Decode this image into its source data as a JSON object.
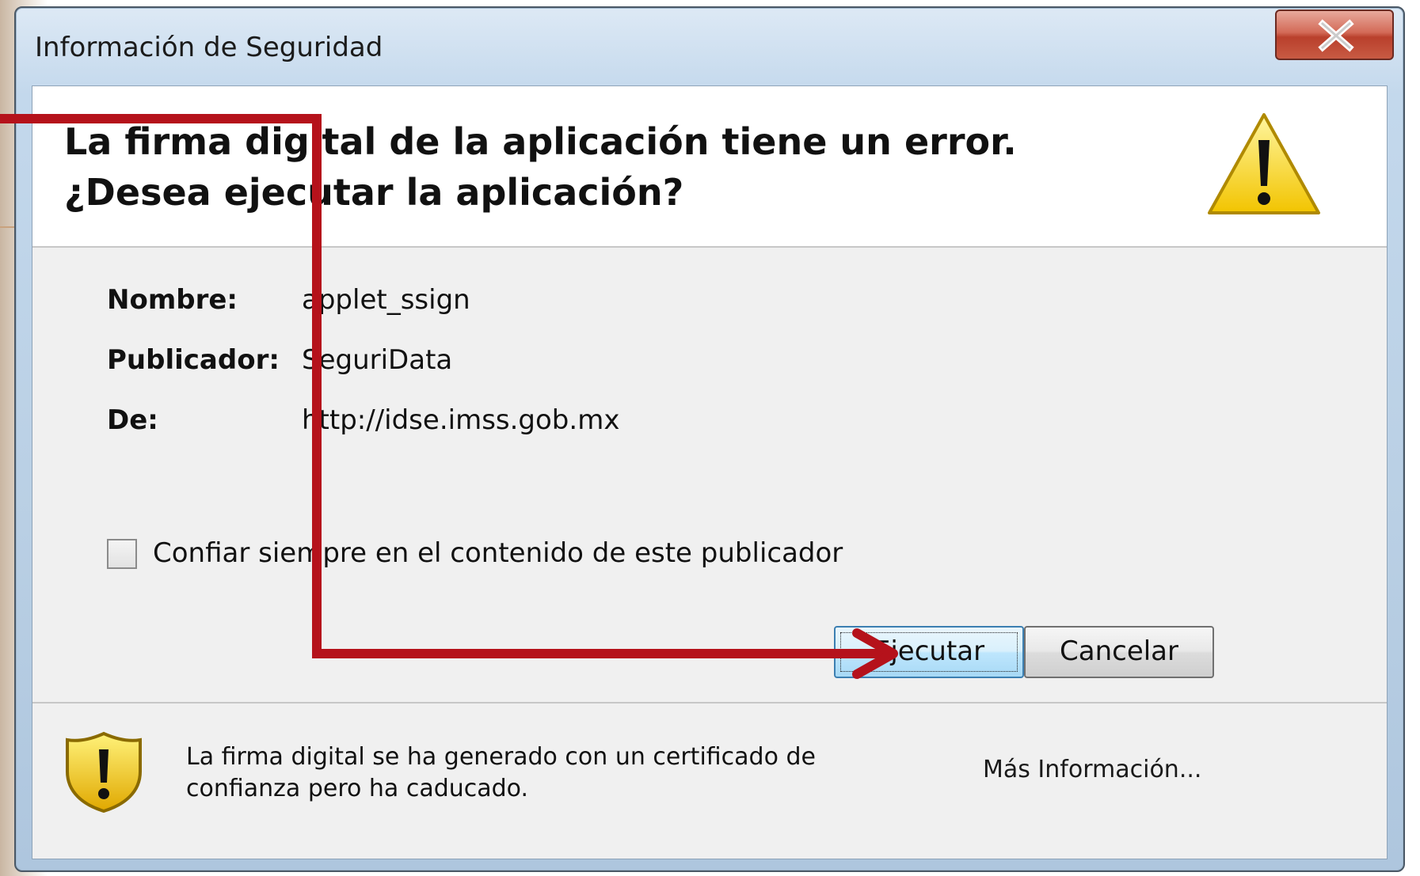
{
  "window": {
    "title": "Información de Seguridad",
    "close_glyph": "X"
  },
  "header": {
    "heading": "La firma digital de la aplicación tiene un error. ¿Desea ejecutar la aplicación?",
    "icon": "warning-icon"
  },
  "details": {
    "name_label": "Nombre:",
    "name_value": "applet_ssign",
    "publisher_label": "Publicador:",
    "publisher_value": "SeguriData",
    "from_label": "De:",
    "from_value": "http://idse.imss.gob.mx"
  },
  "trust_checkbox": {
    "label": "Confiar siempre en el contenido de este publicador",
    "checked": false
  },
  "buttons": {
    "run": "Ejecutar",
    "cancel": "Cancelar"
  },
  "footer": {
    "icon": "shield-warning-icon",
    "message": "La firma digital se ha generado con un certificado de confianza pero ha caducado.",
    "more_info": "Más Información..."
  },
  "colors": {
    "annotation_arrow": "#b5121b",
    "warning_yellow": "#f5d20a",
    "primary_button": "#bee6fd"
  }
}
